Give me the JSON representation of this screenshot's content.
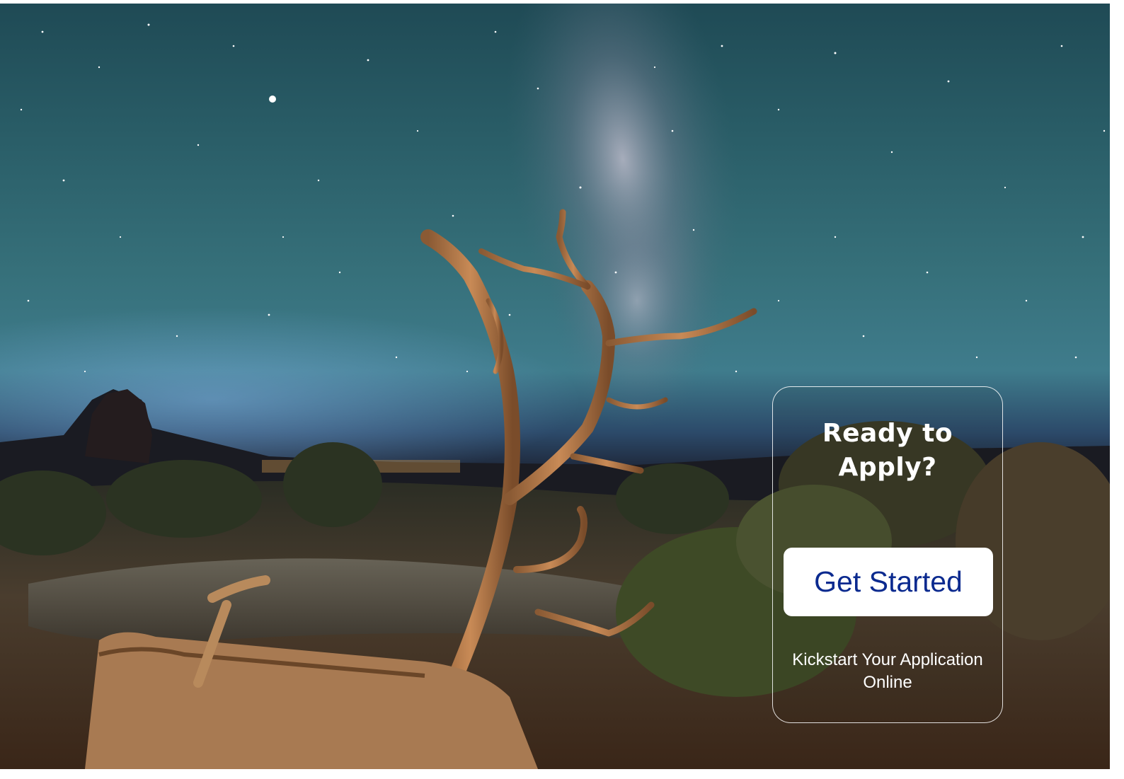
{
  "cta": {
    "title": "Ready to Apply?",
    "button_label": "Get Started",
    "caption": "Kickstart Your Application Online"
  },
  "colors": {
    "button_text": "#0b2a8f",
    "button_background": "#ffffff",
    "card_border": "#ffffff",
    "sky": "#2a5e68",
    "tree": "#b07a4a"
  }
}
